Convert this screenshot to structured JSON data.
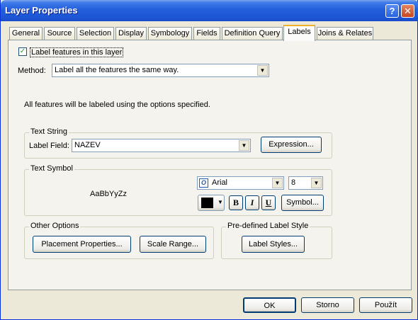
{
  "window": {
    "title": "Layer Properties",
    "help_glyph": "?",
    "close_glyph": "✕"
  },
  "tabs": [
    {
      "label": "General"
    },
    {
      "label": "Source"
    },
    {
      "label": "Selection"
    },
    {
      "label": "Display"
    },
    {
      "label": "Symbology"
    },
    {
      "label": "Fields"
    },
    {
      "label": "Definition Query"
    },
    {
      "label": "Labels",
      "active": true
    },
    {
      "label": "Joins & Relates"
    }
  ],
  "labels_tab": {
    "label_features_checkbox": {
      "label": "Label features in this layer",
      "checked": true
    },
    "method": {
      "label": "Method:",
      "value": "Label all the features the same way."
    },
    "info_text": "All features will be labeled using the options specified.",
    "text_string": {
      "title": "Text String",
      "field_label": "Label Field:",
      "field_value": "NAZEV",
      "expression_button": "Expression..."
    },
    "text_symbol": {
      "title": "Text Symbol",
      "preview": "AaBbYyZz",
      "font": "Arial",
      "size": "8",
      "bold": "B",
      "italic": "I",
      "underline": "U",
      "symbol_button": "Symbol...",
      "color": "#000000"
    },
    "other_options": {
      "title": "Other Options",
      "placement_button": "Placement Properties...",
      "scale_button": "Scale Range..."
    },
    "predefined": {
      "title": "Pre-defined Label Style",
      "styles_button": "Label Styles..."
    }
  },
  "footer": {
    "ok": "OK",
    "cancel": "Storno",
    "apply": "Použít"
  }
}
